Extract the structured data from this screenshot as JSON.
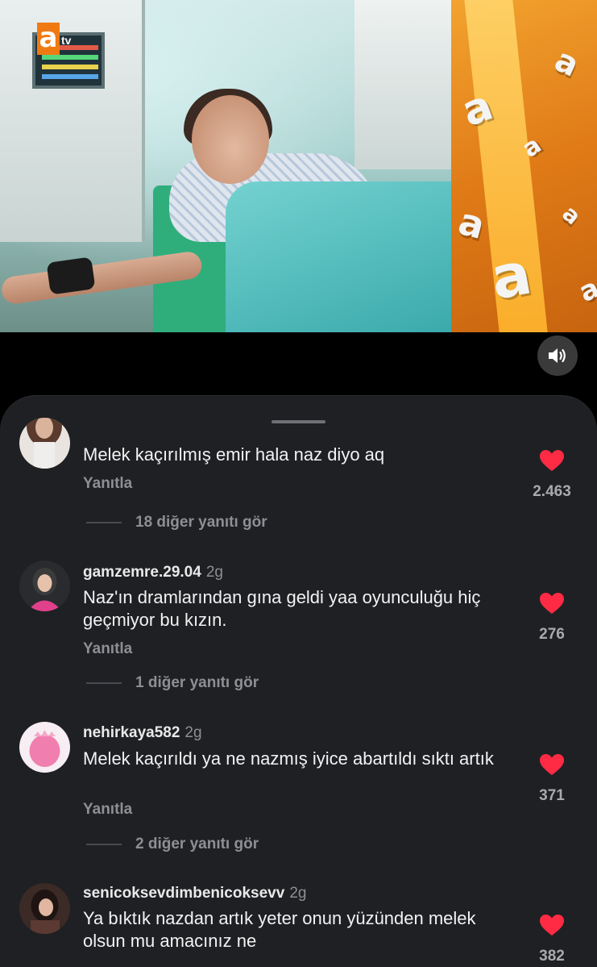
{
  "video": {
    "channel_logo": {
      "letter": "a",
      "suffix": "tv",
      "brand_color": "#f07a12"
    },
    "volume_icon": "speaker-volume-icon",
    "floating_letters": [
      "a",
      "a",
      "a",
      "a",
      "a",
      "a",
      "a"
    ]
  },
  "comments": [
    {
      "username": "",
      "time": "",
      "text": "Melek kaçırılmış emir hala naz diyo aq",
      "reply_label": "Yanıtla",
      "likes": "2.463",
      "more_replies": "18 diğer yanıtı gör"
    },
    {
      "username": "gamzemre.29.04",
      "time": "2g",
      "text": "Naz'ın dramlarından gına geldi yaa oyunculuğu hiç geçmiyor bu kızın.",
      "reply_label": "Yanıtla",
      "likes": "276",
      "more_replies": "1 diğer yanıtı gör"
    },
    {
      "username": "nehirkaya582",
      "time": "2g",
      "text": "Melek kaçırıldı ya ne nazmış iyice abartıldı sıktı artık",
      "reply_label": "Yanıtla",
      "likes": "371",
      "more_replies": "2 diğer yanıtı gör"
    },
    {
      "username": "senicoksevdimbenicoksevv",
      "time": "2g",
      "text": "Ya bıktık nazdan artık yeter onun yüzünden melek olsun mu amacınız ne",
      "reply_label": "",
      "likes": "382",
      "more_replies": ""
    }
  ],
  "colors": {
    "heart": "#ff2b45",
    "panel_bg": "#1f2023"
  }
}
